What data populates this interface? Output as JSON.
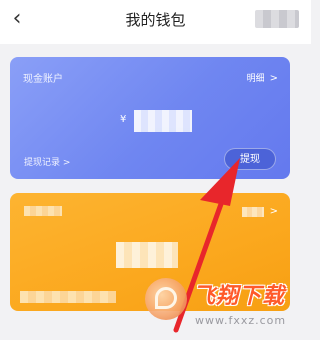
{
  "header": {
    "title": "我的钱包",
    "back_icon": "chevron-left-icon"
  },
  "cash_card": {
    "label": "现金账户",
    "detail": "明细",
    "currency_symbol": "¥",
    "records_link": "提现记录 >",
    "withdraw_button": "提现",
    "color_start": "#8a9ff7",
    "color_end": "#6479ee"
  },
  "second_card": {
    "detail_chevron": ">",
    "color": "#fba81e"
  },
  "annotation": {
    "arrow_color": "#e8262b"
  },
  "watermark": {
    "brand": "飞翔下载",
    "url": "www.fxxz.com"
  }
}
